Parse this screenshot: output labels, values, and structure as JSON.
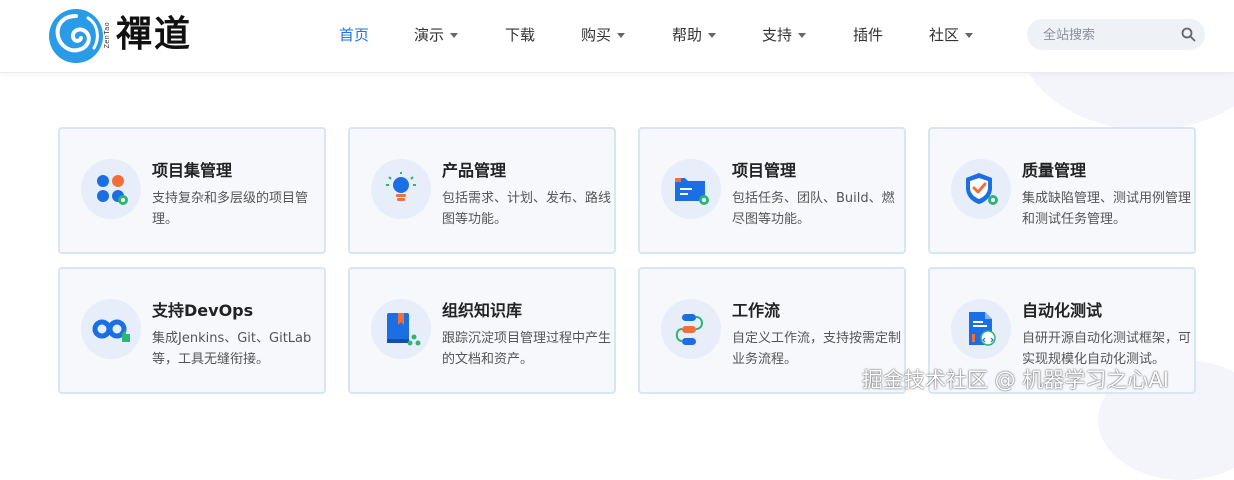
{
  "brand": {
    "logo_text": "禪道",
    "logo_sub": "ZenTao"
  },
  "nav": [
    {
      "label": "首页",
      "active": true,
      "dropdown": false
    },
    {
      "label": "演示",
      "active": false,
      "dropdown": true
    },
    {
      "label": "下载",
      "active": false,
      "dropdown": false
    },
    {
      "label": "购买",
      "active": false,
      "dropdown": true
    },
    {
      "label": "帮助",
      "active": false,
      "dropdown": true
    },
    {
      "label": "支持",
      "active": false,
      "dropdown": true
    },
    {
      "label": "插件",
      "active": false,
      "dropdown": false
    },
    {
      "label": "社区",
      "active": false,
      "dropdown": true
    }
  ],
  "search": {
    "placeholder": "全站搜索",
    "value": ""
  },
  "cards": [
    {
      "icon": "program-icon",
      "title": "项目集管理",
      "desc": "支持复杂和多层级的项目管理。"
    },
    {
      "icon": "lightbulb-icon",
      "title": "产品管理",
      "desc": "包括需求、计划、发布、路线图等功能。"
    },
    {
      "icon": "folder-icon",
      "title": "项目管理",
      "desc": "包括任务、团队、Build、燃尽图等功能。"
    },
    {
      "icon": "shield-check-icon",
      "title": "质量管理",
      "desc": "集成缺陷管理、测试用例管理和测试任务管理。"
    },
    {
      "icon": "infinity-icon",
      "title": "支持DevOps",
      "desc": "集成Jenkins、Git、GitLab等，工具无缝衔接。"
    },
    {
      "icon": "book-icon",
      "title": "组织知识库",
      "desc": "跟踪沉淀项目管理过程中产生的文档和资产。"
    },
    {
      "icon": "workflow-icon",
      "title": "工作流",
      "desc": "自定义工作流，支持按需定制业务流程。"
    },
    {
      "icon": "test-document-icon",
      "title": "自动化测试",
      "desc": "自研开源自动化测试框架，可实现规模化自动化测试。"
    }
  ],
  "watermark": "掘金技术社区 @ 机器学习之心AI",
  "colors": {
    "accent": "#1a73e8",
    "icon_blue": "#1b6fe3",
    "icon_green": "#2bb673",
    "icon_orange": "#f36f3a"
  }
}
